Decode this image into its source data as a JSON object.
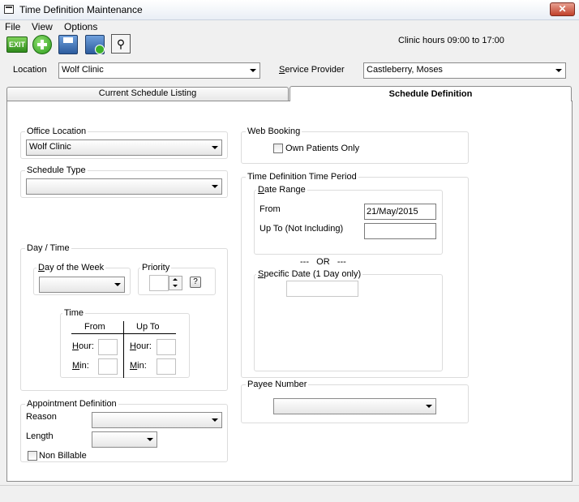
{
  "window": {
    "title": "Time Definition Maintenance",
    "close_label": "✕"
  },
  "menu": [
    "File",
    "View",
    "Options"
  ],
  "toolbar": {
    "exit_label": "EXIT",
    "clinic_hours": "Clinic hours 09:00 to 17:00"
  },
  "header": {
    "location_label": "Location",
    "location_value": "Wolf Clinic",
    "provider_label_prefix": "S",
    "provider_label_rest": "ervice Provider",
    "provider_value": "Castleberry, Moses"
  },
  "tabs": {
    "listing": "Current Schedule Listing",
    "definition": "Schedule Definition"
  },
  "office": {
    "title": "Office Location",
    "value": "Wolf Clinic"
  },
  "schedule_type": {
    "title": "Schedule Type",
    "value": ""
  },
  "day_time": {
    "title": "Day / Time",
    "dow_prefix": "D",
    "dow_rest": "ay of the Week",
    "priority_label": "Priority",
    "help_label": "?",
    "time_title": "Time",
    "from_label": "From",
    "upto_label": "Up To",
    "hour_prefix": "H",
    "hour_rest": "our:",
    "min_prefix": "M",
    "min_rest": "in:"
  },
  "appointment": {
    "title": "Appointment Definition",
    "reason_label": "Reason",
    "length_label": "Length",
    "non_billable_label": "Non Billable"
  },
  "web_booking": {
    "title": "Web Booking",
    "own_patients_label": "Own Patients Only"
  },
  "time_period": {
    "title": "Time Definition Time Period",
    "date_range_prefix": "D",
    "date_range_rest": "ate Range",
    "from_label": "From",
    "from_value": "21/May/2015",
    "upto_label": "Up To (Not Including)",
    "upto_value": "",
    "or_label": "---   OR   ---",
    "specific_prefix": "S",
    "specific_rest": "pecific Date (1 Day only)",
    "specific_value": ""
  },
  "payee": {
    "title": "Payee Number",
    "value": ""
  }
}
